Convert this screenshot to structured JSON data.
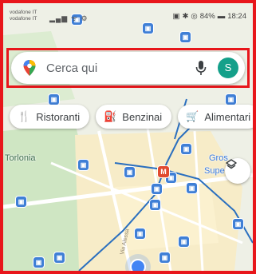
{
  "status_bar": {
    "carrier_line1": "vodafone IT",
    "carrier_line2": "vodafone IT",
    "right_text": "84%",
    "time": "18:24"
  },
  "search": {
    "placeholder": "Cerca qui",
    "avatar_letter": "S",
    "brand_color": "#14a08a"
  },
  "chips": [
    {
      "icon": "restaurant-icon",
      "label": "Ristoranti"
    },
    {
      "icon": "gas-station-icon",
      "label": "Benzinai"
    },
    {
      "icon": "cart-icon",
      "label": "Alimentari"
    }
  ],
  "map": {
    "labels": {
      "torlonia": "Torlonia",
      "gros": "Gros",
      "supe": "Supe",
      "street": "Via Alessa",
      "metro_symbol": "M"
    }
  },
  "colors": {
    "highlight_border": "#e8161b",
    "transit_line": "#2a6fbf",
    "poi": "#3f7fd6",
    "metro": "#e14a2f"
  }
}
